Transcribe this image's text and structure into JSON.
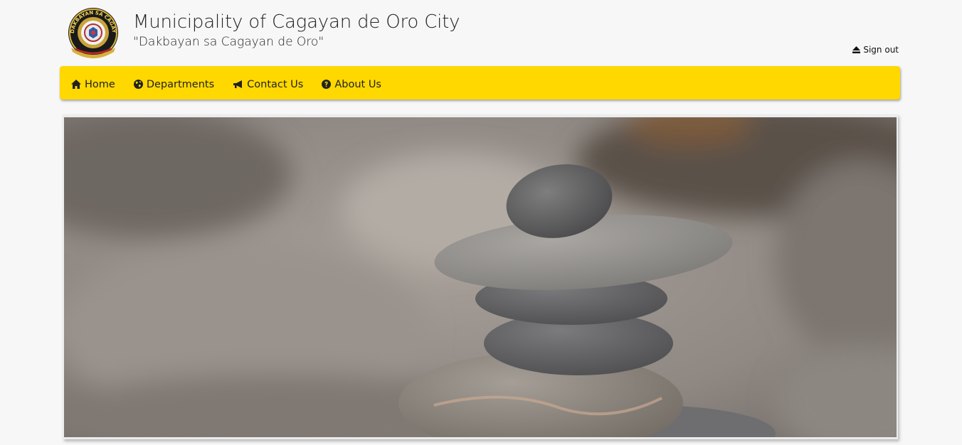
{
  "header": {
    "logo_text": "DAKBAYAN SA CAGAYAN DE ORO",
    "title": "Municipality of Cagayan de Oro City",
    "subtitle": "\"Dakbayan sa Cagayan de Oro\"",
    "signout_label": "Sign out",
    "signout_icon": "eject-icon"
  },
  "nav": {
    "accent_color": "#ffd800",
    "items": [
      {
        "label": "Home",
        "icon": "home-icon"
      },
      {
        "label": "Departments",
        "icon": "globe-icon"
      },
      {
        "label": "Contact Us",
        "icon": "bullhorn-icon"
      },
      {
        "label": "About Us",
        "icon": "question-circle-icon"
      }
    ]
  },
  "hero": {
    "image_subject": "stacked-stones"
  }
}
